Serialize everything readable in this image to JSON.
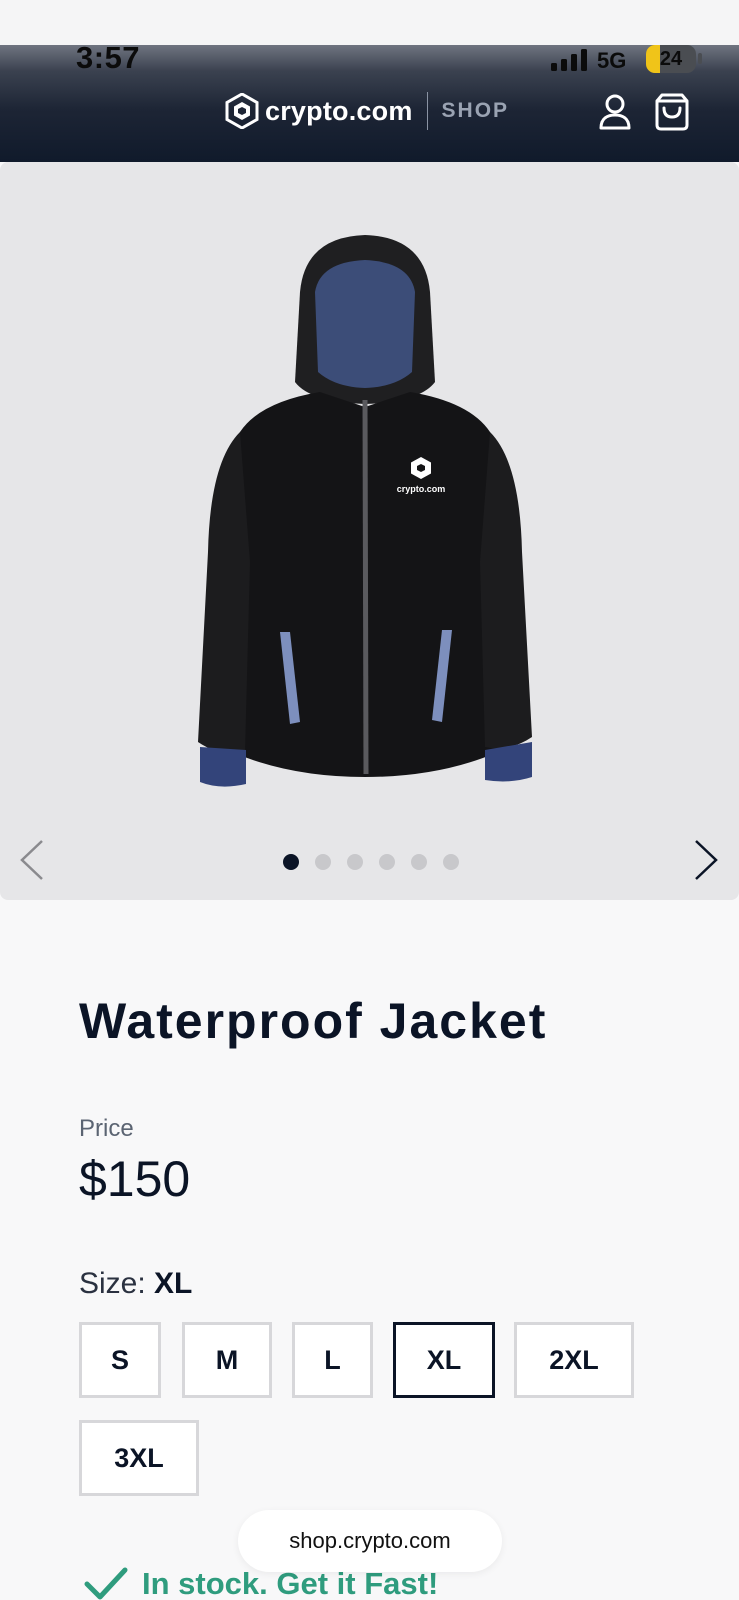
{
  "status_bar": {
    "time": "3:57",
    "network": "5G",
    "battery": "24"
  },
  "header": {
    "brand": "crypto.com",
    "section": "SHOP"
  },
  "gallery": {
    "image_label": "crypto.com",
    "slide_count": 6,
    "active_slide": 1
  },
  "product": {
    "title": "Waterproof Jacket",
    "price_label": "Price",
    "price": "$150",
    "size_label": "Size:",
    "selected_size": "XL",
    "sizes": [
      "S",
      "M",
      "L",
      "XL",
      "2XL",
      "3XL"
    ],
    "stock_text": "In stock. Get it Fast!"
  },
  "browser": {
    "url": "shop.crypto.com"
  },
  "colors": {
    "accent_green": "#2f9c7e",
    "navy": "#0b1426"
  },
  "icons": [
    "signal-icon",
    "crypto-logo-icon",
    "user-icon",
    "shopping-bag-icon",
    "chevron-left-icon",
    "chevron-right-icon",
    "check-icon"
  ]
}
